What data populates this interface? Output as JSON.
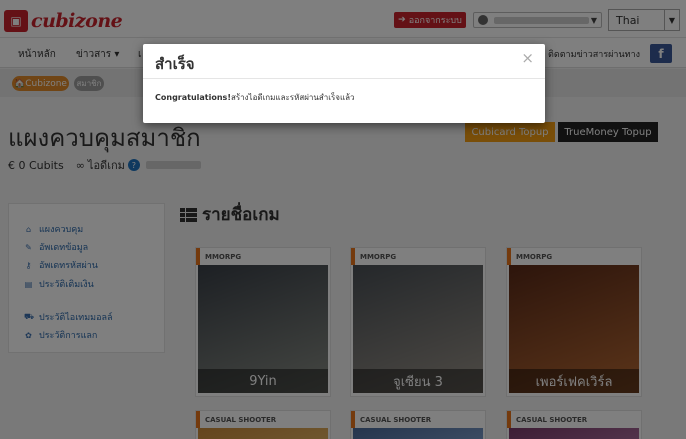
{
  "brand": {
    "name": "cubizone"
  },
  "header": {
    "logout_label": "ออกจากระบบ",
    "language": "Thai"
  },
  "nav": {
    "items": [
      "หน้าหลัก",
      "ข่าวสาร",
      "เ"
    ],
    "right_label": "ติดตามข่าวสารผ่านทาง",
    "facebook": "f"
  },
  "breadcrumb": {
    "home": "Cubizone",
    "current": "สมาชิก"
  },
  "page": {
    "title": "แผงควบคุมสมาชิก",
    "cubits_label": "€ 0 Cubits",
    "game_id_label": "ไอดีเกม",
    "help": "?"
  },
  "topup": {
    "cubicard": "Cubicard Topup",
    "truemoney": "TrueMoney Topup"
  },
  "sidebar": {
    "items": [
      {
        "label": "แผงควบคุม",
        "icon": "home-icon"
      },
      {
        "label": "อัพเดทข้อมูล",
        "icon": "edit-icon"
      },
      {
        "label": "อัพเดทรหัสผ่าน",
        "icon": "key-icon"
      },
      {
        "label": "ประวัติเติมเงิน",
        "icon": "list-icon"
      },
      {
        "label": "ประวัติไอเทมมอลล์",
        "icon": "cart-icon"
      },
      {
        "label": "ประวัติการแลก",
        "icon": "gift-icon"
      }
    ]
  },
  "games": {
    "title": "รายชื่อเกม",
    "cards": [
      {
        "category": "MMORPG",
        "name": "9Yin",
        "colors": [
          "#3a4048",
          "#8a8e86"
        ]
      },
      {
        "category": "MMORPG",
        "name": "จูเซียน 3",
        "colors": [
          "#4a5056",
          "#9b948a"
        ]
      },
      {
        "category": "MMORPG",
        "name": "เพอร์เฟคเวิร์ล",
        "colors": [
          "#5a2a18",
          "#b86a34"
        ]
      },
      {
        "category": "CASUAL SHOOTER",
        "name": "",
        "colors": [
          "#c98a3a",
          "#e0b060"
        ]
      },
      {
        "category": "CASUAL SHOOTER",
        "name": "",
        "colors": [
          "#4a6a9a",
          "#7a9ac8"
        ]
      },
      {
        "category": "CASUAL SHOOTER",
        "name": "",
        "colors": [
          "#7a3a6a",
          "#a86a9a"
        ]
      }
    ]
  },
  "modal": {
    "title": "สำเร็จ",
    "close": "×",
    "message_bold": "Congratulations!",
    "message": "สร้างไอดีเกมและรหัสผ่านสำเร็จแล้ว"
  }
}
